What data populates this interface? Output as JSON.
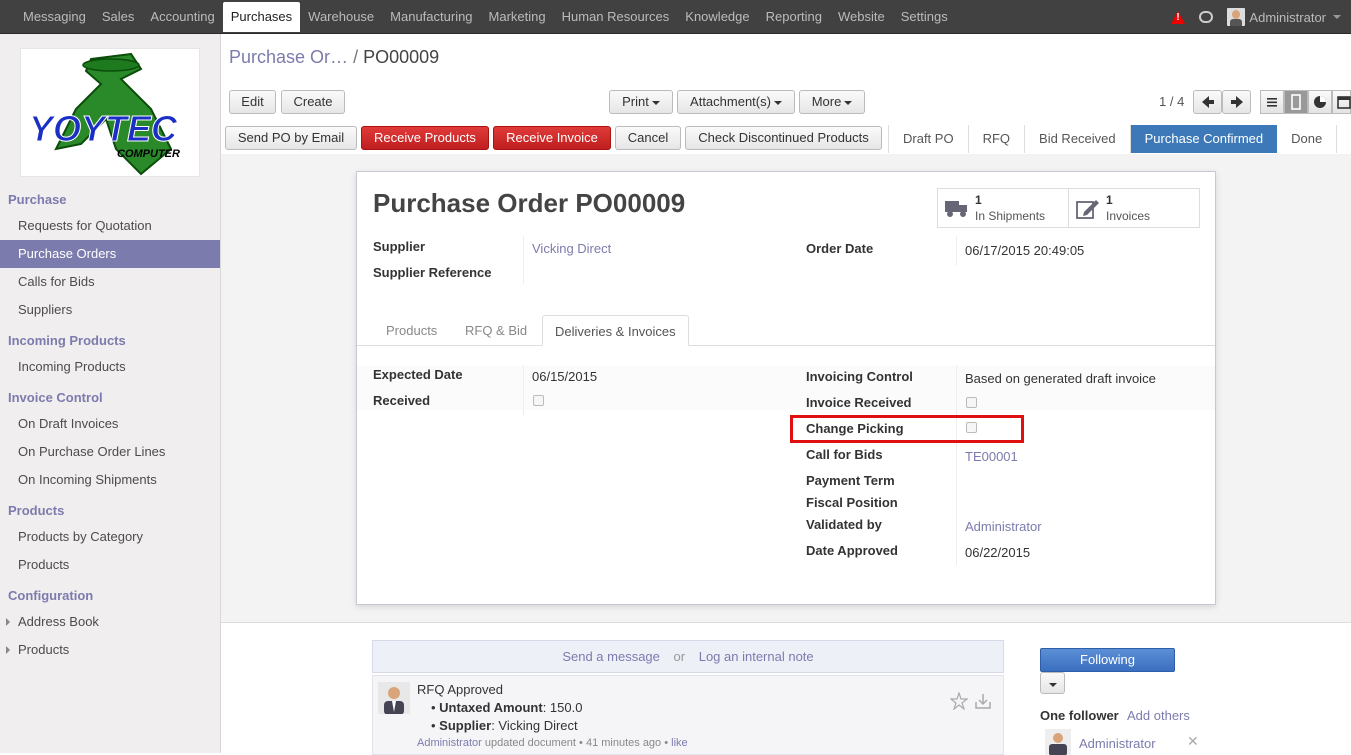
{
  "topbar": {
    "menu": [
      "Messaging",
      "Sales",
      "Accounting",
      "Purchases",
      "Warehouse",
      "Manufacturing",
      "Marketing",
      "Human Resources",
      "Knowledge",
      "Reporting",
      "Website",
      "Settings"
    ],
    "user": "Administrator"
  },
  "logo": {
    "text": "YOYTEC",
    "sub": "COMPUTER"
  },
  "sidebar": {
    "sections": [
      {
        "title": "Purchase",
        "items": [
          "Requests for Quotation",
          "Purchase Orders",
          "Calls for Bids",
          "Suppliers"
        ]
      },
      {
        "title": "Incoming Products",
        "items": [
          "Incoming Products"
        ]
      },
      {
        "title": "Invoice Control",
        "items": [
          "On Draft Invoices",
          "On Purchase Order Lines",
          "On Incoming Shipments"
        ]
      },
      {
        "title": "Products",
        "items": [
          "Products by Category",
          "Products"
        ]
      },
      {
        "title": "Configuration",
        "items": [
          "Address Book",
          "Products"
        ]
      }
    ]
  },
  "breadcrumb": {
    "parent": "Purchase Or…",
    "sep": "/",
    "current": "PO00009"
  },
  "buttons": {
    "edit": "Edit",
    "create": "Create",
    "print": "Print",
    "attachments": "Attachment(s)",
    "more": "More"
  },
  "pager": "1 / 4",
  "actions": [
    "Send PO by Email",
    "Receive Products",
    "Receive Invoice",
    "Cancel",
    "Check Discontinued Products"
  ],
  "stages": [
    "Draft PO",
    "RFQ",
    "Bid Received",
    "Purchase Confirmed",
    "Done"
  ],
  "form": {
    "title_prefix": "Purchase Order",
    "title": "PO00009",
    "smart_buttons": [
      {
        "count": "1",
        "label": "In Shipments"
      },
      {
        "count": "1",
        "label": "Invoices"
      }
    ],
    "supplier_label": "Supplier",
    "supplier": "Vicking Direct",
    "supplier_ref_label": "Supplier Reference",
    "order_date_label": "Order Date",
    "order_date": "06/17/2015 20:49:05",
    "tabs": [
      "Products",
      "RFQ & Bid",
      "Deliveries & Invoices"
    ],
    "expected_date_label": "Expected Date",
    "expected_date": "06/15/2015",
    "received_label": "Received",
    "invoicing_control_label": "Invoicing Control",
    "invoicing_control": "Based on generated draft invoice",
    "invoice_received_label": "Invoice Received",
    "change_picking_label": "Change Picking",
    "call_for_bids_label": "Call for Bids",
    "call_for_bids": "TE00001",
    "payment_term_label": "Payment Term",
    "fiscal_position_label": "Fiscal Position",
    "validated_by_label": "Validated by",
    "validated_by": "Administrator",
    "date_approved_label": "Date Approved",
    "date_approved": "06/22/2015"
  },
  "chatter": {
    "send_message": "Send a message",
    "or": "or",
    "log_note": "Log an internal note",
    "following": "Following",
    "followers": "One follower",
    "add_others": "Add others",
    "follower_name": "Administrator",
    "message": {
      "title": "RFQ Approved",
      "line1_label": "Untaxed Amount",
      "line1_value": ": 150.0",
      "line2_label": "Supplier",
      "line2_value": ": Vicking Direct",
      "author": "Administrator",
      "meta": "updated document • 41 minutes ago •",
      "like": "like"
    }
  }
}
